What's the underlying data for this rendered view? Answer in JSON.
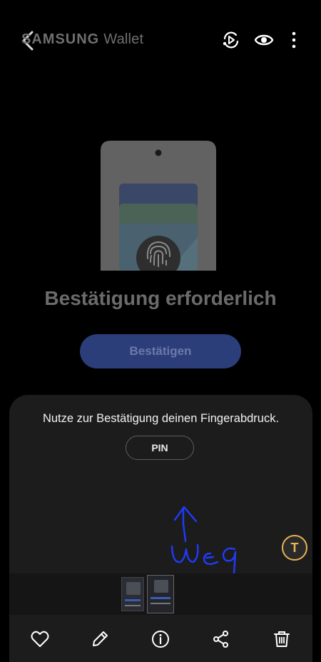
{
  "header": {
    "brand_primary": "SAMSUNG",
    "brand_secondary": "Wallet",
    "back_icon": "chevron-left-icon",
    "icons": [
      "screen-recorder-icon",
      "eye-icon",
      "more-vertical-icon"
    ]
  },
  "main": {
    "title": "Bestätigung erforderlich",
    "confirm_label": "Bestätigen"
  },
  "sheet": {
    "message": "Nutze zur Bestätigung deinen Fingerabdruck.",
    "pin_label": "PIN",
    "annotation_text": "weg",
    "actions": [
      "heart-icon",
      "pencil-icon",
      "info-icon",
      "share-icon",
      "trash-icon"
    ]
  },
  "colors": {
    "background": "#000000",
    "accent_blue": "#2b3e7a",
    "sheet_bg": "#1c1c1c",
    "scribble_blue": "#1f3bff",
    "text_button_ring": "#e7b453"
  }
}
